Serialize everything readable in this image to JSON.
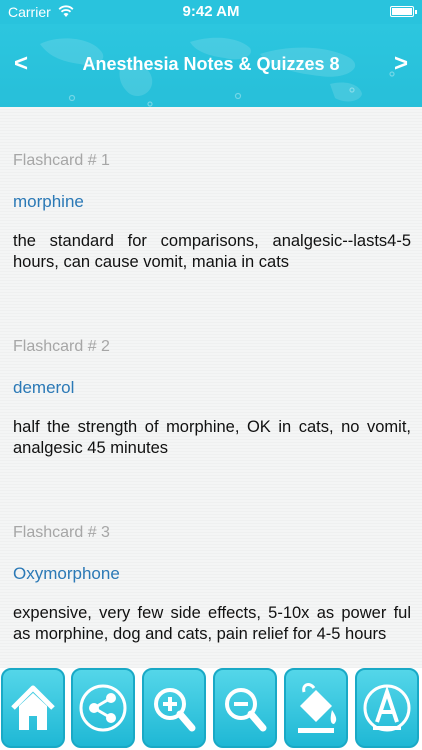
{
  "status": {
    "carrier": "Carrier",
    "time": "9:42 AM"
  },
  "nav": {
    "title": "Anesthesia Notes & Quizzes 8",
    "back": "<",
    "forward": ">"
  },
  "flashcards": [
    {
      "label": "Flashcard # 1",
      "term": "morphine",
      "definition": "the standard for comparisons, analgesic--lasts4-5 hours, can cause vomit, mania in cats"
    },
    {
      "label": "Flashcard # 2",
      "term": "demerol",
      "definition": "half the strength of morphine, OK in cats, no vomit, analgesic 45 minutes"
    },
    {
      "label": "Flashcard # 3",
      "term": "Oxymorphone",
      "definition": "expensive, very few side effects, 5-10x as power ful as morphine, dog and cats, pain relief for 4-5 hours"
    }
  ],
  "toolbar": {
    "icons": [
      "home-icon",
      "share-icon",
      "zoom-in-icon",
      "zoom-out-icon",
      "paint-bucket-icon",
      "font-icon"
    ]
  }
}
